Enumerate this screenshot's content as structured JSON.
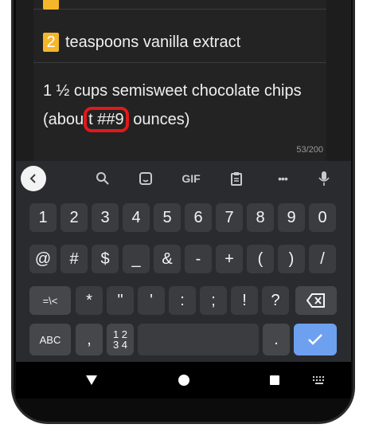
{
  "ingredients": {
    "row2": {
      "badge": "2",
      "text": "teaspoons vanilla extract"
    },
    "editor": {
      "line1": "1 ½ cups semisweet chocolate chips",
      "line2_before": "(abou",
      "line2_highlight": "t ##9",
      "line2_after": "ounces)"
    },
    "counter": "53/200"
  },
  "keyboard": {
    "toolbar": [
      "back",
      "search-icon",
      "sticker-icon",
      "GIF",
      "clipboard-icon",
      "more-icon",
      "mic-icon"
    ],
    "gif_label": "GIF",
    "more_label": "•••",
    "row1": [
      "1",
      "2",
      "3",
      "4",
      "5",
      "6",
      "7",
      "8",
      "9",
      "0"
    ],
    "row2": [
      "@",
      "#",
      "$",
      "_",
      "&",
      "-",
      "+",
      "(",
      ")",
      "/"
    ],
    "row3": [
      "=\\<",
      "*",
      "\"",
      "'",
      ":",
      ";",
      "!",
      "?"
    ],
    "row4": {
      "abc": "ABC",
      "comma": ",",
      "numpad_top": "1 2",
      "numpad_bottom": "3 4",
      "period": "."
    }
  },
  "accent_colors": {
    "badge": "#f4b62b",
    "highlight": "#e0191b",
    "enter": "#6ea0f0"
  }
}
